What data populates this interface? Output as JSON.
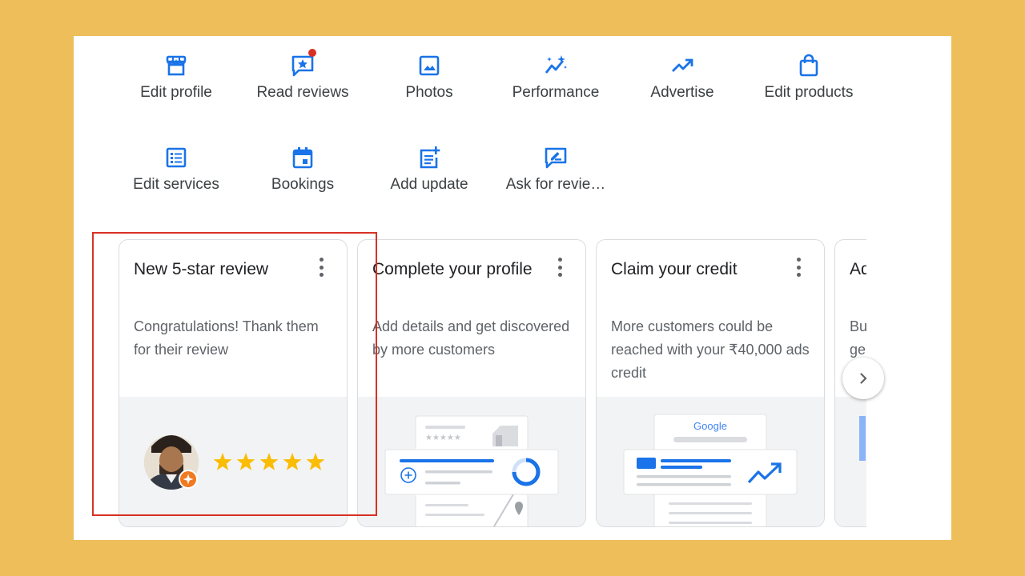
{
  "quick_actions": [
    {
      "label": "Edit profile",
      "icon": "storefront-icon",
      "badge": false
    },
    {
      "label": "Read reviews",
      "icon": "review-star-icon",
      "badge": true
    },
    {
      "label": "Photos",
      "icon": "photo-icon",
      "badge": false
    },
    {
      "label": "Performance",
      "icon": "performance-sparkle-icon",
      "badge": false
    },
    {
      "label": "Advertise",
      "icon": "trending-up-icon",
      "badge": false
    },
    {
      "label": "Edit products",
      "icon": "shopping-bag-icon",
      "badge": false
    },
    {
      "label": "Edit services",
      "icon": "list-icon",
      "badge": false
    },
    {
      "label": "Bookings",
      "icon": "calendar-icon",
      "badge": false
    },
    {
      "label": "Add update",
      "icon": "post-add-icon",
      "badge": false
    },
    {
      "label": "Ask for revie…",
      "icon": "rate-review-icon",
      "badge": false
    }
  ],
  "cards": [
    {
      "title": "New 5-star review",
      "desc": "Congratulations! Thank them for their review",
      "stars": 5
    },
    {
      "title": "Complete your profile",
      "desc": "Add details and get discovered by more customers"
    },
    {
      "title": "Claim your credit",
      "desc": "More customers could be reached with your ₹40,000 ads credit",
      "brand_text": "Google"
    },
    {
      "title": "Ad",
      "desc": "Bu ge"
    }
  ],
  "colors": {
    "accent": "#1a73e8",
    "star": "#fbbc04",
    "badge_red": "#d93025",
    "highlight": "#d93025",
    "frame": "#EDBE5A"
  }
}
